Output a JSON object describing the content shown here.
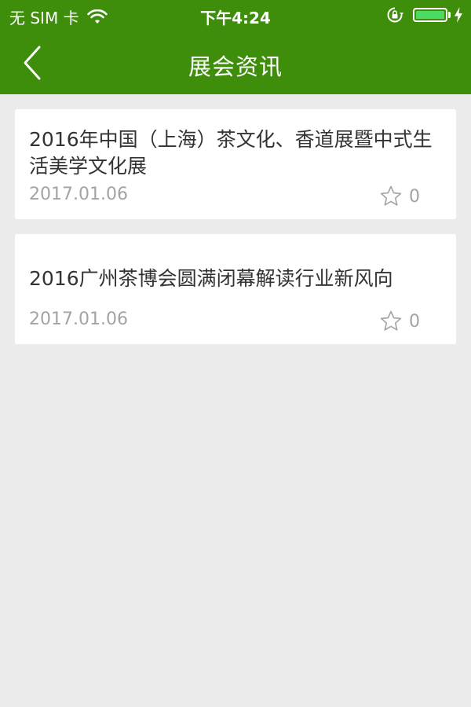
{
  "status_bar": {
    "carrier": "无 SIM 卡",
    "time": "下午4:24",
    "battery_level": 1.0,
    "battery_color": "#4cd964"
  },
  "nav": {
    "title": "展会资讯",
    "back_icon": "chevron-left-icon",
    "bar_color": "#3e8e0c"
  },
  "news": [
    {
      "title": "2016年中国（上海）茶文化、香道展暨中式生活美学文化展",
      "date": "2017.01.06",
      "favorites": "0"
    },
    {
      "title": "2016广州茶博会圆满闭幕解读行业新风向",
      "date": "2017.01.06",
      "favorites": "0"
    }
  ]
}
